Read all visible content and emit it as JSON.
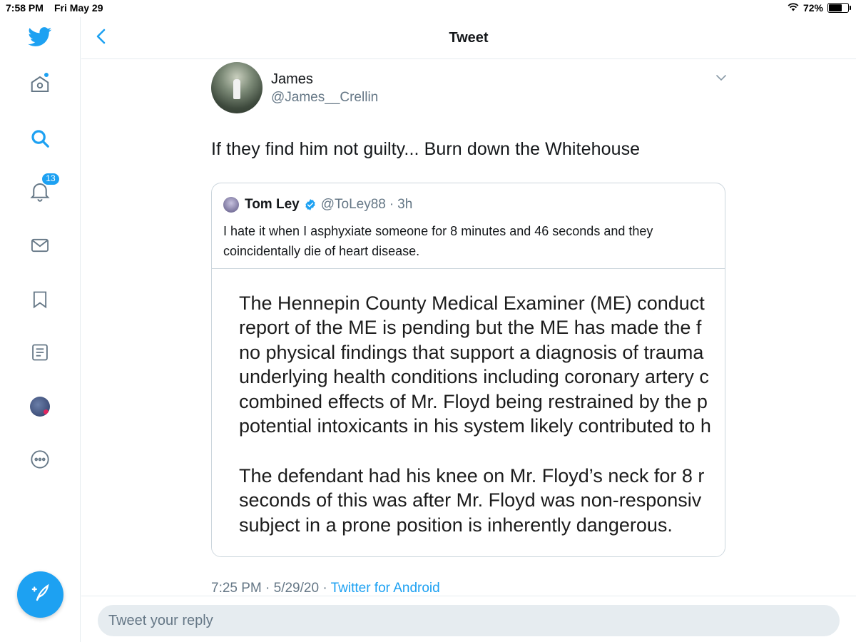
{
  "status_bar": {
    "time": "7:58 PM",
    "date": "Fri May 29",
    "battery": "72%",
    "battery_level": 0.72,
    "wifi_icon": "wifi-icon"
  },
  "sidebar": {
    "items": [
      {
        "name": "twitter-logo-icon",
        "color": "#1da1f2"
      },
      {
        "name": "home-icon",
        "has_dot": true
      },
      {
        "name": "search-icon",
        "active": true
      },
      {
        "name": "notifications-icon",
        "badge": "13"
      },
      {
        "name": "messages-icon"
      },
      {
        "name": "bookmarks-icon"
      },
      {
        "name": "lists-icon"
      },
      {
        "name": "profile-avatar"
      },
      {
        "name": "more-icon"
      }
    ],
    "compose_icon": "compose-tweet-icon"
  },
  "header": {
    "title": "Tweet",
    "back_icon": "chevron-left-icon"
  },
  "tweet": {
    "author_name": "James",
    "author_handle": "@James__Crellin",
    "text": "If they find him not guilty... Burn down the Whitehouse",
    "caret_icon": "chevron-down-icon",
    "timestamp": "7:25 PM · 5/29/20 · ",
    "source": "Twitter for Android"
  },
  "quoted_tweet": {
    "name": "Tom Ley",
    "handle": "@ToLey88",
    "separator": "·",
    "time": "3h",
    "verified_icon": "verified-badge-icon",
    "text": "I hate it when I asphyxiate someone for 8 minutes and 46 seconds and they coincidentally die of heart disease.",
    "image_paragraph_1": [
      "The Hennepin County Medical Examiner (ME) conduct",
      "report of the ME is pending but the ME has made the f",
      "no physical findings that support a diagnosis of trauma",
      "underlying health conditions including coronary artery c",
      "combined effects of Mr. Floyd being restrained by the p",
      "potential intoxicants in his system likely contributed to h"
    ],
    "image_paragraph_2": [
      "The defendant had his knee on Mr. Floyd’s neck for 8 r",
      "seconds of this was after Mr. Floyd was non-responsiv",
      "subject in a prone position is inherently dangerous."
    ]
  },
  "reply": {
    "placeholder": "Tweet your reply"
  },
  "colors": {
    "accent": "#1da1f2",
    "text_primary": "#14171a",
    "text_secondary": "#657786",
    "border": "#e6ecf0"
  }
}
